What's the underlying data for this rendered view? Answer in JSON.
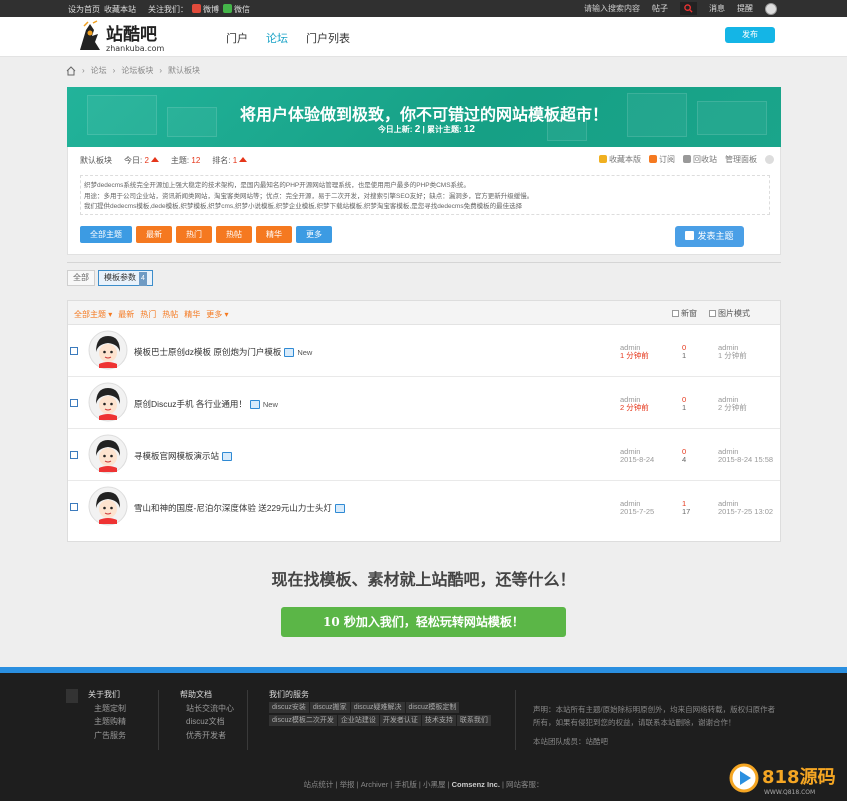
{
  "topbar": {
    "set_home": "设为首页",
    "favorite": "收藏本站",
    "follow_label": "关注我们：",
    "weibo": "微博",
    "wechat": "微信",
    "search_placeholder": "请输入搜索内容",
    "search_type": "帖子",
    "messages": "消息",
    "reminders": "提醒"
  },
  "header": {
    "logo_text": "站酷吧",
    "logo_sub": "zhankuba.com",
    "nav": [
      "门户",
      "论坛",
      "门户列表"
    ],
    "post_button": "发布"
  },
  "breadcrumb": [
    "论坛",
    "论坛板块",
    "默认板块"
  ],
  "banner": {
    "title": "将用户体验做到极致，你不可错过的网站模板超市！",
    "today_label": "今日上新:",
    "today_value": "2",
    "total_label": "| 累计主题:",
    "total_value": "12"
  },
  "forum": {
    "name": "默认板块",
    "today_label": "今日:",
    "today_value": "2",
    "topics_label": "主题:",
    "topics_value": "12",
    "rank_label": "排名:",
    "rank_value": "1",
    "tools": [
      "收藏本版",
      "订阅",
      "回收站",
      "管理面板"
    ],
    "description": [
      "织梦dedecms系统完全开源加上强大稳定的技术架构，是国内最知名的PHP开源网站管理系统，也是使用用户最多的PHP类CMS系统。",
      "用途：多用于公司企业站，资讯新闻类网站，淘宝客类网站等；优点：完全开源，易于二次开发，对搜索引擎SEO友好；缺点：漏洞多，官方更新升级缓慢。",
      "我们提供dedecms模板,dede模板,织梦模板,织梦cms,织梦小说模板,织梦企业模板,织梦下载站模板,织梦淘宝客模板,是您寻找dedecms免费模板的最佳选择"
    ],
    "filter_buttons": [
      "全部主题",
      "最新",
      "热门",
      "热帖",
      "精华",
      "更多"
    ],
    "post_topic": "发表主题"
  },
  "tabs": [
    {
      "label": "全部"
    },
    {
      "label": "模板参数",
      "count": "4"
    }
  ],
  "list": {
    "filters": [
      "全部主题",
      "最新",
      "热门",
      "热帖",
      "精华",
      "更多"
    ],
    "new_window": "新窗",
    "image_mode": "图片模式",
    "rows": [
      {
        "title": "模板巴士原创dz模板 原创炮为门户模板",
        "new": "New",
        "author": "admin",
        "time": "1 分钟前",
        "replies": "0",
        "views": "1",
        "last_user": "admin",
        "last_time": "1 分钟前"
      },
      {
        "title": "原创Discuz手机 各行业通用！",
        "new": "New",
        "author": "admin",
        "time": "2 分钟前",
        "replies": "0",
        "views": "1",
        "last_user": "admin",
        "last_time": "2 分钟前"
      },
      {
        "title": "寻模板官网模板演示站",
        "new": "",
        "author": "admin",
        "time": "2015-8-24",
        "replies": "0",
        "views": "4",
        "last_user": "admin",
        "last_time": "2015-8-24 15:58"
      },
      {
        "title": "雪山和神的国度-尼泊尔深度体验 送229元山力士头灯",
        "new": "",
        "author": "admin",
        "time": "2015-7-25",
        "replies": "1",
        "views": "17",
        "last_user": "admin",
        "last_time": "2015-7-25 13:02"
      }
    ]
  },
  "cta": {
    "headline": "现在找模板、素材就上站酷吧，还等什么！",
    "button": "10 秒加入我们，轻松玩转网站模板！"
  },
  "footer": {
    "about": {
      "title": "关于我们",
      "items": [
        "主题定制",
        "主题购精",
        "广告服务"
      ]
    },
    "help": {
      "title": "帮助文档",
      "items": [
        "站长交流中心",
        "discuz文档",
        "优秀开发者"
      ]
    },
    "services": {
      "title": "我们的服务",
      "tags": [
        "discuz安装",
        "discuz搬家",
        "discuz疑难解决",
        "discuz模板定制",
        "discuz模板二次开发",
        "企业站建设",
        "开发者认证",
        "技术支持",
        "联系我们"
      ]
    },
    "statement": "声明：本站所有主题/原始除标明原创外，均来自网络转载，版权归原作者所有，如果有侵犯到您的权益，请联系本站删除，谢谢合作！",
    "team": "本站团队成员：站酷吧",
    "bottom": [
      "站点统计",
      "举报",
      "Archiver",
      "手机版",
      "小黑屋",
      "Comsenz Inc.",
      "网站客服："
    ]
  },
  "watermark": {
    "text": "818源码",
    "url": "WWW.Q818.COM"
  }
}
